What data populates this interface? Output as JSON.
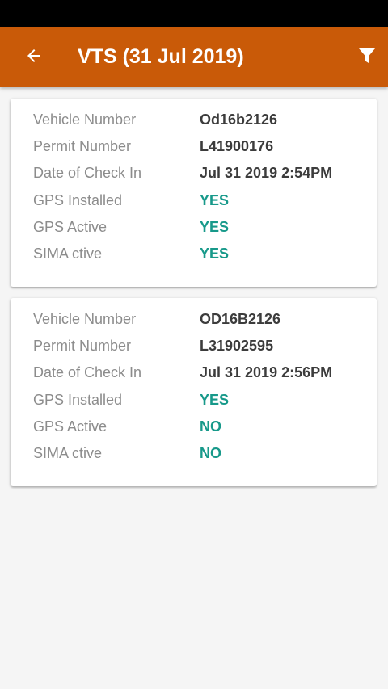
{
  "header": {
    "title": "VTS (31 Jul 2019)",
    "back_icon": "arrow-left-icon",
    "filter_icon": "filter-icon",
    "color": "#c95a08"
  },
  "colors": {
    "status_value": "#17998a",
    "label": "#8c8c8c",
    "value": "#3c3c3c"
  },
  "records": [
    {
      "fields": [
        {
          "label": "Vehicle Number",
          "value": "Od16b2126"
        },
        {
          "label": "Permit Number",
          "value": "L41900176"
        },
        {
          "label": "Date of Check In",
          "value": "Jul 31 2019 2:54PM"
        },
        {
          "label": "GPS Installed",
          "value": "YES"
        },
        {
          "label": "GPS Active",
          "value": "YES"
        },
        {
          "label": "SIMA ctive",
          "value": "YES"
        }
      ]
    },
    {
      "fields": [
        {
          "label": "Vehicle Number",
          "value": "OD16B2126"
        },
        {
          "label": "Permit Number",
          "value": "L31902595"
        },
        {
          "label": "Date of Check In",
          "value": "Jul 31 2019 2:56PM"
        },
        {
          "label": "GPS Installed",
          "value": "YES"
        },
        {
          "label": "GPS Active",
          "value": "NO"
        },
        {
          "label": "SIMA ctive",
          "value": "NO"
        }
      ]
    }
  ]
}
